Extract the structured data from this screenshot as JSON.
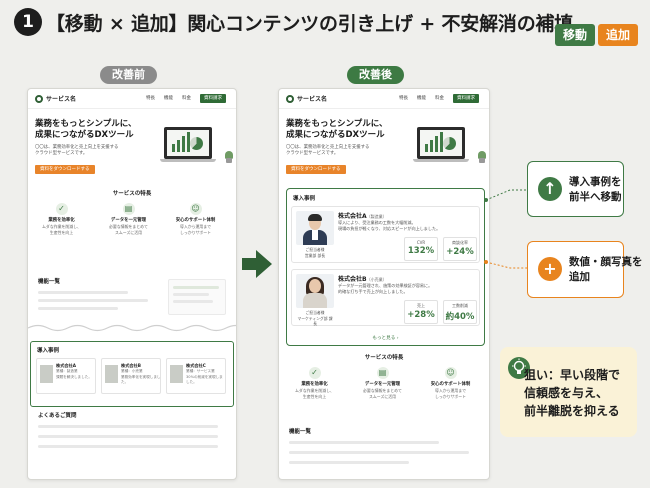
{
  "header": {
    "step_number": "1",
    "title": "【移動 × 追加】関心コンテンツの引き上げ + 不安解消の補填",
    "tag_move": "移動",
    "tag_add": "追加"
  },
  "labels": {
    "before": "改善前",
    "after": "改善後"
  },
  "mock_site": {
    "site_name": "サービス名",
    "nav_links": [
      "特長",
      "機能",
      "料金"
    ],
    "nav_cta": "資料請求",
    "hero_heading_line1": "業務をもっとシンプルに、",
    "hero_heading_line2": "成果につながるDXツール",
    "hero_sub_line1": "〇〇は、業務効率化と売上向上を支援する",
    "hero_sub_line2": "クラウド型サービスです。",
    "hero_button": "資料をダウンロードする",
    "features_title": "サービスの特長",
    "features": [
      {
        "title": "業務を効率化",
        "desc1": "ムダな作業を削減し、",
        "desc2": "生産性を向上"
      },
      {
        "title": "データを一元管理",
        "desc1": "必要な情報をまとめて",
        "desc2": "スムーズに活用"
      },
      {
        "title": "安心のサポート体制",
        "desc1": "導入から運用まで",
        "desc2": "しっかりサポート"
      }
    ],
    "function_title": "機能一覧",
    "faq_title": "よくあるご質問",
    "cases_title": "導入事例"
  },
  "before_cases": [
    {
      "name": "株式会社A",
      "sub1": "業種：製造業",
      "sub2": "課題を解決しました。"
    },
    {
      "name": "株式会社B",
      "sub1": "業種：小売業",
      "sub2": "業務効率化を実現しました。"
    },
    {
      "name": "株式会社C",
      "sub1": "業種：サービス業",
      "sub2": "30%の削減を実現しました。"
    }
  ],
  "after_cases": {
    "title": "導入事例",
    "more_link": "もっと見る ›",
    "cards": [
      {
        "company": "株式会社A",
        "industry": "（製造業）",
        "desc1": "導入により、受注業務の工数を大幅削減。",
        "desc2": "現場の負担が軽くなり、対応スピードが向上しました。",
        "person_role": "ご担当者様",
        "person_dept": "営業部 部長",
        "metrics": [
          {
            "label": "CVR",
            "value": "132%"
          },
          {
            "label": "商談化率",
            "value": "+24%"
          }
        ]
      },
      {
        "company": "株式会社B",
        "industry": "（小売業）",
        "desc1": "データが一元管理され、施策の効果検証が容易に。",
        "desc2": "的確な打ち手で売上が向上しました。",
        "person_role": "ご担当者様",
        "person_dept": "マーケティング部 課長",
        "metrics": [
          {
            "label": "売上",
            "value": "+28%"
          },
          {
            "label": "工数削減",
            "value": "約40%"
          }
        ]
      }
    ]
  },
  "callouts": {
    "move_line1": "導入事例を",
    "move_line2": "前半へ移動",
    "add_line1": "数値・顔写真を",
    "add_line2": "追加",
    "aim_line1": "狙い：早い段階で",
    "aim_line2": "信頼感を与え、",
    "aim_line3": "前半離脱を抑える"
  },
  "colors": {
    "green": "#3f7a45",
    "orange": "#e8841e",
    "aim_bg": "#faf2d7"
  }
}
